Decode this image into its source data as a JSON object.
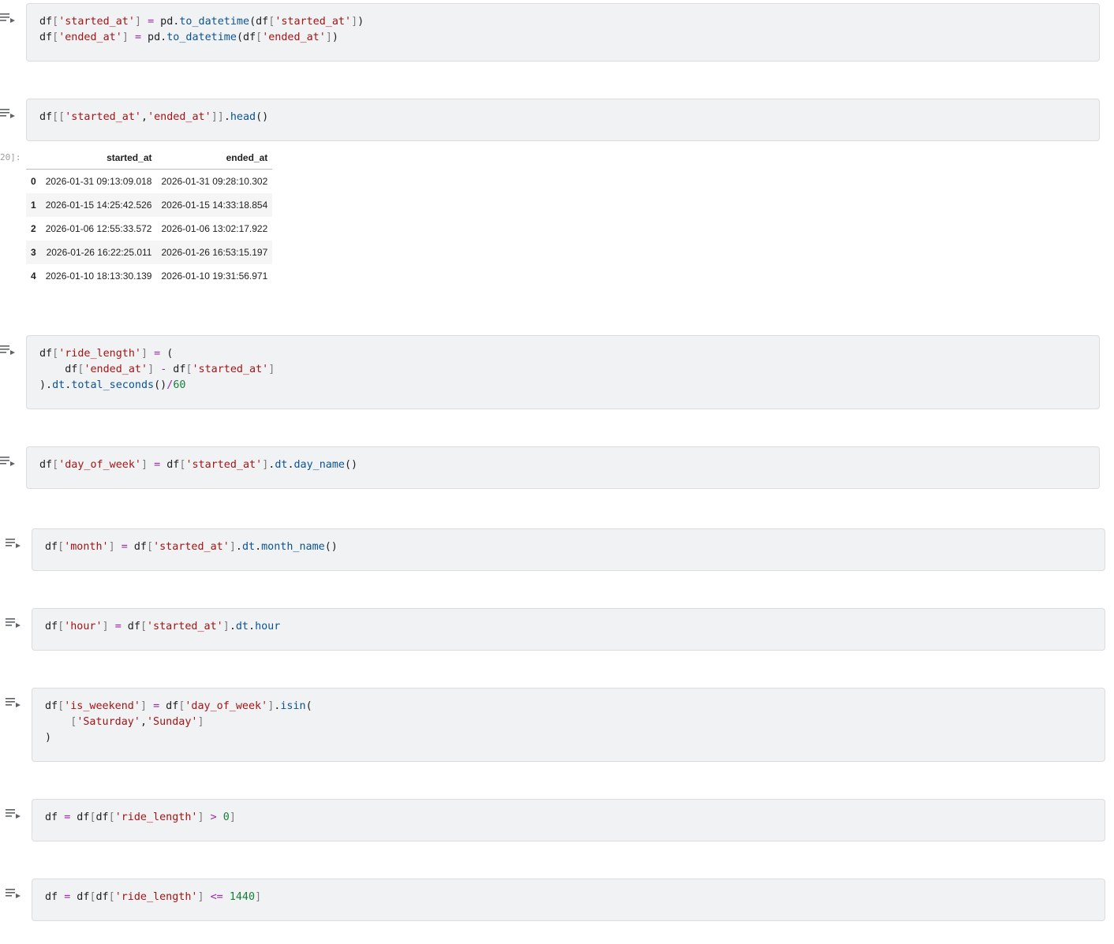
{
  "cells": [
    {
      "id": "c1",
      "lines": [
        [
          [
            "t",
            "df"
          ],
          [
            "p",
            "["
          ],
          [
            "s",
            "'started_at'"
          ],
          [
            "p",
            "]"
          ],
          [
            "t",
            " "
          ],
          [
            "op",
            "="
          ],
          [
            "t",
            " pd."
          ],
          [
            "f",
            "to_datetime"
          ],
          [
            "t",
            "(df"
          ],
          [
            "p",
            "["
          ],
          [
            "s",
            "'started_at'"
          ],
          [
            "p",
            "]"
          ],
          [
            "t",
            ")"
          ]
        ],
        [
          [
            "t",
            "df"
          ],
          [
            "p",
            "["
          ],
          [
            "s",
            "'ended_at'"
          ],
          [
            "p",
            "]"
          ],
          [
            "t",
            " "
          ],
          [
            "op",
            "="
          ],
          [
            "t",
            " pd."
          ],
          [
            "f",
            "to_datetime"
          ],
          [
            "t",
            "(df"
          ],
          [
            "p",
            "["
          ],
          [
            "s",
            "'ended_at'"
          ],
          [
            "p",
            "]"
          ],
          [
            "t",
            ")"
          ]
        ]
      ]
    },
    {
      "id": "c2",
      "lines": [
        [
          [
            "t",
            "df"
          ],
          [
            "p",
            "[["
          ],
          [
            "s",
            "'started_at'"
          ],
          [
            "t",
            ","
          ],
          [
            "s",
            "'ended_at'"
          ],
          [
            "p",
            "]]"
          ],
          [
            "t",
            "."
          ],
          [
            "f",
            "head"
          ],
          [
            "t",
            "()"
          ]
        ]
      ]
    },
    {
      "id": "c3",
      "lines": [
        [
          [
            "t",
            "df"
          ],
          [
            "p",
            "["
          ],
          [
            "s",
            "'ride_length'"
          ],
          [
            "p",
            "]"
          ],
          [
            "t",
            " "
          ],
          [
            "op",
            "="
          ],
          [
            "t",
            " ("
          ]
        ],
        [
          [
            "t",
            "    df"
          ],
          [
            "p",
            "["
          ],
          [
            "s",
            "'ended_at'"
          ],
          [
            "p",
            "]"
          ],
          [
            "t",
            " "
          ],
          [
            "op",
            "-"
          ],
          [
            "t",
            " df"
          ],
          [
            "p",
            "["
          ],
          [
            "s",
            "'started_at'"
          ],
          [
            "p",
            "]"
          ]
        ],
        [
          [
            "t",
            ")."
          ],
          [
            "f",
            "dt"
          ],
          [
            "t",
            "."
          ],
          [
            "f",
            "total_seconds"
          ],
          [
            "t",
            "()"
          ],
          [
            "op",
            "/"
          ],
          [
            "n",
            "60"
          ]
        ]
      ]
    },
    {
      "id": "c4",
      "lines": [
        [
          [
            "t",
            "df"
          ],
          [
            "p",
            "["
          ],
          [
            "s",
            "'day_of_week'"
          ],
          [
            "p",
            "]"
          ],
          [
            "t",
            " "
          ],
          [
            "op",
            "="
          ],
          [
            "t",
            " df"
          ],
          [
            "p",
            "["
          ],
          [
            "s",
            "'started_at'"
          ],
          [
            "p",
            "]"
          ],
          [
            "t",
            "."
          ],
          [
            "f",
            "dt"
          ],
          [
            "t",
            "."
          ],
          [
            "f",
            "day_name"
          ],
          [
            "t",
            "()"
          ]
        ]
      ]
    },
    {
      "id": "c5",
      "lines": [
        [
          [
            "t",
            "df"
          ],
          [
            "p",
            "["
          ],
          [
            "s",
            "'month'"
          ],
          [
            "p",
            "]"
          ],
          [
            "t",
            " "
          ],
          [
            "op",
            "="
          ],
          [
            "t",
            " df"
          ],
          [
            "p",
            "["
          ],
          [
            "s",
            "'started_at'"
          ],
          [
            "p",
            "]"
          ],
          [
            "t",
            "."
          ],
          [
            "f",
            "dt"
          ],
          [
            "t",
            "."
          ],
          [
            "f",
            "month_name"
          ],
          [
            "t",
            "()"
          ]
        ]
      ]
    },
    {
      "id": "c6",
      "lines": [
        [
          [
            "t",
            "df"
          ],
          [
            "p",
            "["
          ],
          [
            "s",
            "'hour'"
          ],
          [
            "p",
            "]"
          ],
          [
            "t",
            " "
          ],
          [
            "op",
            "="
          ],
          [
            "t",
            " df"
          ],
          [
            "p",
            "["
          ],
          [
            "s",
            "'started_at'"
          ],
          [
            "p",
            "]"
          ],
          [
            "t",
            "."
          ],
          [
            "f",
            "dt"
          ],
          [
            "t",
            "."
          ],
          [
            "f",
            "hour"
          ]
        ]
      ]
    },
    {
      "id": "c7",
      "lines": [
        [
          [
            "t",
            "df"
          ],
          [
            "p",
            "["
          ],
          [
            "s",
            "'is_weekend'"
          ],
          [
            "p",
            "]"
          ],
          [
            "t",
            " "
          ],
          [
            "op",
            "="
          ],
          [
            "t",
            " df"
          ],
          [
            "p",
            "["
          ],
          [
            "s",
            "'day_of_week'"
          ],
          [
            "p",
            "]"
          ],
          [
            "t",
            "."
          ],
          [
            "f",
            "isin"
          ],
          [
            "t",
            "("
          ]
        ],
        [
          [
            "t",
            "    "
          ],
          [
            "p",
            "["
          ],
          [
            "s",
            "'Saturday'"
          ],
          [
            "t",
            ","
          ],
          [
            "s",
            "'Sunday'"
          ],
          [
            "p",
            "]"
          ]
        ],
        [
          [
            "t",
            ")"
          ]
        ]
      ]
    },
    {
      "id": "c8",
      "lines": [
        [
          [
            "t",
            "df "
          ],
          [
            "op",
            "="
          ],
          [
            "t",
            " df"
          ],
          [
            "p",
            "["
          ],
          [
            "t",
            "df"
          ],
          [
            "p",
            "["
          ],
          [
            "s",
            "'ride_length'"
          ],
          [
            "p",
            "]"
          ],
          [
            "t",
            " "
          ],
          [
            "op",
            ">"
          ],
          [
            "t",
            " "
          ],
          [
            "n",
            "0"
          ],
          [
            "p",
            "]"
          ]
        ]
      ]
    },
    {
      "id": "c9",
      "lines": [
        [
          [
            "t",
            "df "
          ],
          [
            "op",
            "="
          ],
          [
            "t",
            " df"
          ],
          [
            "p",
            "["
          ],
          [
            "t",
            "df"
          ],
          [
            "p",
            "["
          ],
          [
            "s",
            "'ride_length'"
          ],
          [
            "p",
            "]"
          ],
          [
            "t",
            " "
          ],
          [
            "op",
            "<="
          ],
          [
            "t",
            " "
          ],
          [
            "n",
            "1440"
          ],
          [
            "p",
            "]"
          ]
        ]
      ]
    }
  ],
  "output": {
    "prompt": "20]:",
    "columns": [
      "started_at",
      "ended_at"
    ],
    "rows": [
      {
        "index": "0",
        "started_at": "2026-01-31 09:13:09.018",
        "ended_at": "2026-01-31 09:28:10.302"
      },
      {
        "index": "1",
        "started_at": "2026-01-15 14:25:42.526",
        "ended_at": "2026-01-15 14:33:18.854"
      },
      {
        "index": "2",
        "started_at": "2026-01-06 12:55:33.572",
        "ended_at": "2026-01-06 13:02:17.922"
      },
      {
        "index": "3",
        "started_at": "2026-01-26 16:22:25.011",
        "ended_at": "2026-01-26 16:53:15.197"
      },
      {
        "index": "4",
        "started_at": "2026-01-10 18:13:30.139",
        "ended_at": "2026-01-10 19:31:56.971"
      }
    ]
  },
  "icons": {
    "run": "run-cell-icon"
  }
}
